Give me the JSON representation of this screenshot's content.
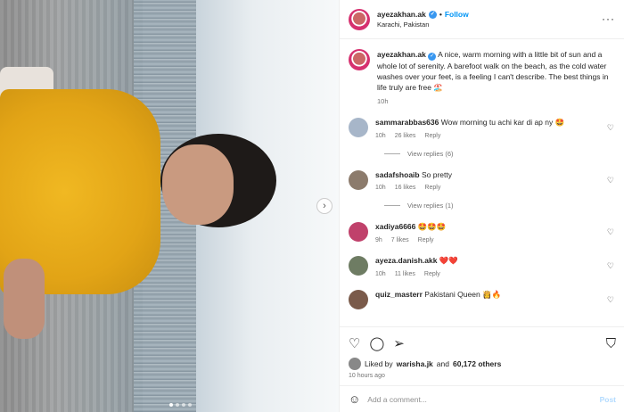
{
  "header": {
    "username": "ayezakhan.ak",
    "follow_label": "Follow",
    "location": "Karachi, Pakistan",
    "more_icon": "more-options-icon"
  },
  "caption": {
    "username": "ayezakhan.ak",
    "text": "A nice, warm morning with a little bit of sun and a whole lot of serenity. A barefoot walk on the beach, as the cold water washes over your feet, is a feeling I can't describe. The best things in life truly are free 🏖️",
    "time": "10h"
  },
  "comments": [
    {
      "username": "sammarabbas636",
      "text": "Wow morning tu achi kar di ap ny 🤩",
      "time": "10h",
      "likes": "26 likes",
      "reply": "Reply",
      "view_replies": "View replies (6)",
      "avatar_color": "#a7b6c9"
    },
    {
      "username": "sadafshoaib",
      "text": "So pretty",
      "time": "10h",
      "likes": "16 likes",
      "reply": "Reply",
      "view_replies": "View replies (1)",
      "avatar_color": "#8c7b6c"
    },
    {
      "username": "xadiya6666",
      "text": "🤩🤩🤩",
      "time": "9h",
      "likes": "7 likes",
      "reply": "Reply",
      "avatar_color": "#c0416b"
    },
    {
      "username": "ayeza.danish.akk",
      "text": "❤️❤️",
      "time": "10h",
      "likes": "11 likes",
      "reply": "Reply",
      "avatar_color": "#6e7c63"
    },
    {
      "username": "quiz_masterr",
      "text": "Pakistani Queen 👸🔥",
      "time": "",
      "likes": "",
      "reply": "",
      "avatar_color": "#7a5a4a"
    }
  ],
  "actions": {
    "liked_prefix": "Liked by",
    "liked_user": "warisha.jk",
    "liked_and": "and",
    "liked_count": "60,172 others",
    "ago": "10 hours ago"
  },
  "add_comment": {
    "placeholder": "Add a comment...",
    "post_label": "Post"
  },
  "colors": {
    "accent": "#0095f6",
    "verified": "#3897f0",
    "post_disabled": "#b3dbff"
  }
}
